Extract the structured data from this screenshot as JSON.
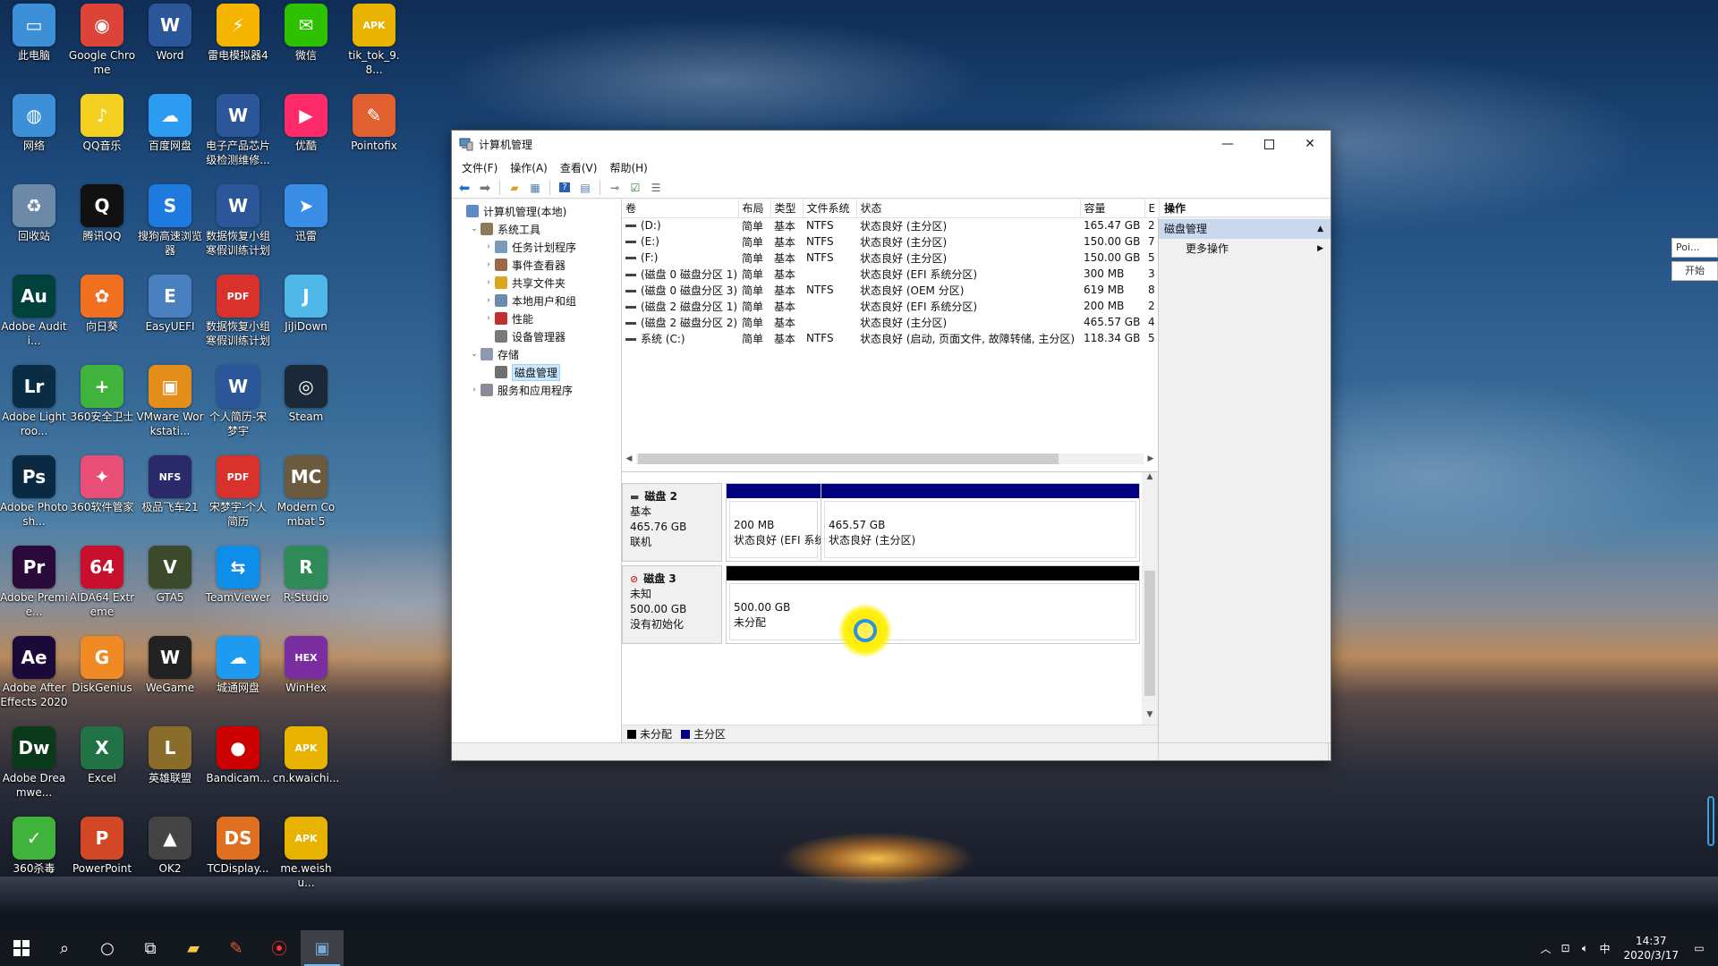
{
  "desktop": {
    "icons": [
      {
        "label": "此电脑",
        "icon": "computer-icon",
        "color": "#3d8fd8",
        "glyph": "▭"
      },
      {
        "label": "Google Chrome",
        "icon": "chrome-icon",
        "color": "#db4437",
        "glyph": "◉"
      },
      {
        "label": "Word",
        "icon": "word-icon",
        "color": "#2b579a",
        "glyph": "W"
      },
      {
        "label": "雷电模拟器4",
        "icon": "ldplayer-icon",
        "color": "#f5b400",
        "glyph": "⚡"
      },
      {
        "label": "微信",
        "icon": "wechat-icon",
        "color": "#2dc100",
        "glyph": "✉"
      },
      {
        "label": "tik_tok_9.8...",
        "icon": "apk-icon",
        "color": "#e8b300",
        "glyph": "APK"
      },
      {
        "label": "网络",
        "icon": "network-icon",
        "color": "#3d8fd8",
        "glyph": "◍"
      },
      {
        "label": "QQ音乐",
        "icon": "qqmusic-icon",
        "color": "#f4d021",
        "glyph": "♪"
      },
      {
        "label": "百度网盘",
        "icon": "baidu-netdisk-icon",
        "color": "#2d9bf0",
        "glyph": "☁"
      },
      {
        "label": "电子产品芯片级检测维修...",
        "icon": "word-doc-icon",
        "color": "#2b579a",
        "glyph": "W"
      },
      {
        "label": "优酷",
        "icon": "youku-icon",
        "color": "#ff2a6a",
        "glyph": "▶"
      },
      {
        "label": "Pointofix",
        "icon": "pointofix-icon",
        "color": "#e06030",
        "glyph": "✎"
      },
      {
        "label": "回收站",
        "icon": "recycle-bin-icon",
        "color": "#6c8aa8",
        "glyph": "♻"
      },
      {
        "label": "腾讯QQ",
        "icon": "qq-icon",
        "color": "#111111",
        "glyph": "Q"
      },
      {
        "label": "搜狗高速浏览器",
        "icon": "sogou-icon",
        "color": "#1f7ae0",
        "glyph": "S"
      },
      {
        "label": "数据恢复小组寒假训练计划",
        "icon": "word-doc-icon",
        "color": "#2b579a",
        "glyph": "W"
      },
      {
        "label": "迅雷",
        "icon": "thunder-icon",
        "color": "#3a8ee6",
        "glyph": "➤"
      },
      {
        "label": "Adobe Auditi...",
        "icon": "audition-icon",
        "color": "#00403d",
        "glyph": "Au"
      },
      {
        "label": "向日葵",
        "icon": "sunflower-icon",
        "color": "#f07020",
        "glyph": "✿"
      },
      {
        "label": "EasyUEFI",
        "icon": "easyuefi-icon",
        "color": "#4a7fc0",
        "glyph": "E"
      },
      {
        "label": "数据恢复小组寒假训练计划",
        "icon": "pdf-icon",
        "color": "#d9312b",
        "glyph": "PDF"
      },
      {
        "label": "JiJiDown",
        "icon": "jijidown-icon",
        "color": "#4fb8e8",
        "glyph": "J"
      },
      {
        "label": "Adobe Lightroo...",
        "icon": "lightroom-icon",
        "color": "#0a2c44",
        "glyph": "Lr"
      },
      {
        "label": "360安全卫士",
        "icon": "360-safe-icon",
        "color": "#3fb33b",
        "glyph": "+"
      },
      {
        "label": "VMware Workstati...",
        "icon": "vmware-icon",
        "color": "#e58d1a",
        "glyph": "▣"
      },
      {
        "label": "个人简历-宋梦宇",
        "icon": "word-doc-icon",
        "color": "#2b579a",
        "glyph": "W"
      },
      {
        "label": "Steam",
        "icon": "steam-icon",
        "color": "#1b2838",
        "glyph": "◎"
      },
      {
        "label": "Adobe Photosh...",
        "icon": "photoshop-icon",
        "color": "#0a2a44",
        "glyph": "Ps"
      },
      {
        "label": "360软件管家",
        "icon": "360-software-icon",
        "color": "#e94e77",
        "glyph": "✦"
      },
      {
        "label": "极品飞车21",
        "icon": "nfs-icon",
        "color": "#2a2a6a",
        "glyph": "NFS"
      },
      {
        "label": "宋梦宇-个人简历",
        "icon": "pdf-icon",
        "color": "#d9312b",
        "glyph": "PDF"
      },
      {
        "label": "Modern Combat 5",
        "icon": "modern-combat-icon",
        "color": "#6b5a3e",
        "glyph": "MC"
      },
      {
        "label": "Adobe Premie...",
        "icon": "premiere-icon",
        "color": "#2a0a3a",
        "glyph": "Pr"
      },
      {
        "label": "AIDA64 Extreme",
        "icon": "aida64-icon",
        "color": "#c8102e",
        "glyph": "64"
      },
      {
        "label": "GTA5",
        "icon": "gta5-icon",
        "color": "#3a4a2a",
        "glyph": "V"
      },
      {
        "label": "TeamViewer",
        "icon": "teamviewer-icon",
        "color": "#0e8ee9",
        "glyph": "⇆"
      },
      {
        "label": "R-Studio",
        "icon": "rstudio-icon",
        "color": "#2e8b57",
        "glyph": "R"
      },
      {
        "label": "Adobe After Effects 2020",
        "icon": "after-effects-icon",
        "color": "#1a0a3a",
        "glyph": "Ae"
      },
      {
        "label": "DiskGenius",
        "icon": "diskgenius-icon",
        "color": "#f08a24",
        "glyph": "G"
      },
      {
        "label": "WeGame",
        "icon": "wegame-icon",
        "color": "#222222",
        "glyph": "W"
      },
      {
        "label": "城通网盘",
        "icon": "ctfile-icon",
        "color": "#1e9bf0",
        "glyph": "☁"
      },
      {
        "label": "WinHex",
        "icon": "winhex-icon",
        "color": "#7a2ea0",
        "glyph": "HEX"
      },
      {
        "label": "Adobe Dreamwe...",
        "icon": "dreamweaver-icon",
        "color": "#0a3a1a",
        "glyph": "Dw"
      },
      {
        "label": "Excel",
        "icon": "excel-icon",
        "color": "#217346",
        "glyph": "X"
      },
      {
        "label": "英雄联盟",
        "icon": "lol-icon",
        "color": "#8a6d2b",
        "glyph": "L"
      },
      {
        "label": "Bandicam...",
        "icon": "bandicam-icon",
        "color": "#cc0000",
        "glyph": "●"
      },
      {
        "label": "cn.kwaichi...",
        "icon": "apk-icon",
        "color": "#e8b300",
        "glyph": "APK"
      },
      {
        "label": "360杀毒",
        "icon": "360-antivirus-icon",
        "color": "#3fb33b",
        "glyph": "✓"
      },
      {
        "label": "PowerPoint",
        "icon": "powerpoint-icon",
        "color": "#d24726",
        "glyph": "P"
      },
      {
        "label": "OK2",
        "icon": "ok2-icon",
        "color": "#444444",
        "glyph": "▲"
      },
      {
        "label": "TCDisplay...",
        "icon": "tcdisplay-icon",
        "color": "#e07020",
        "glyph": "DS"
      },
      {
        "label": "me.weishu...",
        "icon": "apk-icon",
        "color": "#e8b300",
        "glyph": "APK"
      }
    ]
  },
  "window": {
    "title": "计算机管理",
    "menu": [
      "文件(F)",
      "操作(A)",
      "查看(V)",
      "帮助(H)"
    ],
    "tree": [
      {
        "label": "计算机管理(本地)",
        "level": 0,
        "exp": "",
        "icon": "computer-mgmt-icon"
      },
      {
        "label": "系统工具",
        "level": 1,
        "exp": "⌄",
        "icon": "tools-icon"
      },
      {
        "label": "任务计划程序",
        "level": 2,
        "exp": "›",
        "icon": "task-scheduler-icon"
      },
      {
        "label": "事件查看器",
        "level": 2,
        "exp": "›",
        "icon": "event-viewer-icon"
      },
      {
        "label": "共享文件夹",
        "level": 2,
        "exp": "›",
        "icon": "shared-folder-icon"
      },
      {
        "label": "本地用户和组",
        "level": 2,
        "exp": "›",
        "icon": "users-icon"
      },
      {
        "label": "性能",
        "level": 2,
        "exp": "›",
        "icon": "performance-icon"
      },
      {
        "label": "设备管理器",
        "level": 2,
        "exp": "",
        "icon": "device-manager-icon"
      },
      {
        "label": "存储",
        "level": 1,
        "exp": "⌄",
        "icon": "storage-icon"
      },
      {
        "label": "磁盘管理",
        "level": 2,
        "exp": "",
        "icon": "disk-mgmt-icon",
        "selected": true
      },
      {
        "label": "服务和应用程序",
        "level": 1,
        "exp": "›",
        "icon": "services-icon"
      }
    ],
    "columns": [
      "卷",
      "布局",
      "类型",
      "文件系统",
      "状态",
      "容量",
      "E"
    ],
    "volumes": [
      [
        "(D:)",
        "简单",
        "基本",
        "NTFS",
        "状态良好 (主分区)",
        "165.47 GB",
        "2"
      ],
      [
        "(E:)",
        "简单",
        "基本",
        "NTFS",
        "状态良好 (主分区)",
        "150.00 GB",
        "7"
      ],
      [
        "(F:)",
        "简单",
        "基本",
        "NTFS",
        "状态良好 (主分区)",
        "150.00 GB",
        "5"
      ],
      [
        "(磁盘 0 磁盘分区 1)",
        "简单",
        "基本",
        "",
        "状态良好 (EFI 系统分区)",
        "300 MB",
        "3"
      ],
      [
        "(磁盘 0 磁盘分区 3)",
        "简单",
        "基本",
        "NTFS",
        "状态良好 (OEM 分区)",
        "619 MB",
        "8"
      ],
      [
        "(磁盘 2 磁盘分区 1)",
        "简单",
        "基本",
        "",
        "状态良好 (EFI 系统分区)",
        "200 MB",
        "2"
      ],
      [
        "(磁盘 2 磁盘分区 2)",
        "简单",
        "基本",
        "",
        "状态良好 (主分区)",
        "465.57 GB",
        "4"
      ],
      [
        "系统 (C:)",
        "简单",
        "基本",
        "NTFS",
        "状态良好 (启动, 页面文件, 故障转储, 主分区)",
        "118.34 GB",
        "5"
      ]
    ],
    "disks": [
      {
        "name": "磁盘 2",
        "type": "基本",
        "size": "465.76 GB",
        "status": "联机",
        "partitions": [
          {
            "size": "200 MB",
            "status": "状态良好 (EFI 系统分",
            "bar": "#000080"
          },
          {
            "size": "465.57 GB",
            "status": "状态良好 (主分区)",
            "bar": "#000080"
          }
        ]
      },
      {
        "name": "磁盘 3",
        "type": "未知",
        "size": "500.00 GB",
        "status": "没有初始化",
        "partitions": [
          {
            "size": "500.00 GB",
            "status": "未分配",
            "bar": "#000000"
          }
        ]
      }
    ],
    "legend": [
      {
        "label": "未分配",
        "color": "#000000"
      },
      {
        "label": "主分区",
        "color": "#000080"
      }
    ],
    "actions": {
      "header": "操作",
      "section": "磁盘管理",
      "item": "更多操作"
    }
  },
  "sidepanel": {
    "input": "Poi...",
    "button": "开始"
  },
  "taskbar": {
    "ime": "中",
    "time": "14:37",
    "date": "2020/3/17"
  }
}
